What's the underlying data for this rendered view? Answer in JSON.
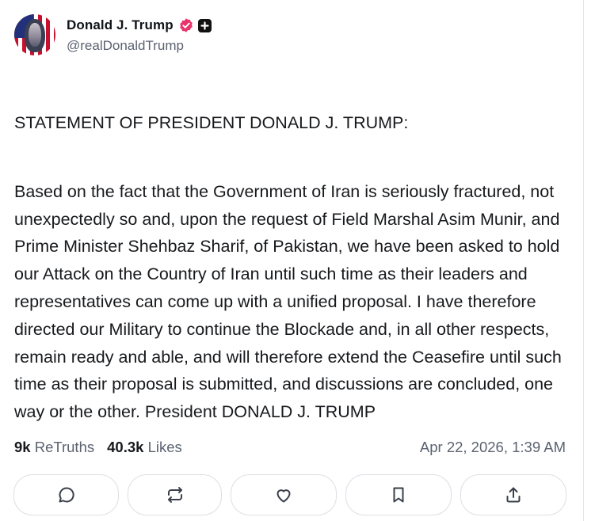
{
  "author": {
    "display_name": "Donald J. Trump",
    "handle": "@realDonaldTrump",
    "verified_icon": "verified-badge-icon",
    "badge_icon": "plus-badge-icon"
  },
  "post": {
    "heading": "STATEMENT OF PRESIDENT DONALD J. TRUMP:",
    "body": "Based on the fact that the Government of Iran is seriously fractured, not unexpectedly so and, upon the request of Field Marshal Asim Munir, and Prime Minister Shehbaz Sharif, of Pakistan, we have been asked to hold our Attack on the Country of Iran until such time as their leaders and representatives can come up with a unified proposal. I have therefore directed our Military to continue the Blockade and, in all other respects, remain ready and able, and will therefore extend the Ceasefire until such time as their proposal is submitted, and discussions are concluded, one way or the other. President DONALD J. TRUMP"
  },
  "stats": {
    "retruths_count": "9k",
    "retruths_label": "ReTruths",
    "likes_count": "40.3k",
    "likes_label": "Likes"
  },
  "timestamp": "Apr 22, 2026, 1:39 AM",
  "actions": [
    {
      "icon": "reply-icon"
    },
    {
      "icon": "retruth-icon"
    },
    {
      "icon": "like-icon"
    },
    {
      "icon": "bookmark-icon"
    },
    {
      "icon": "share-icon"
    }
  ],
  "colors": {
    "verified": "#e8336b",
    "text": "#17191c",
    "muted": "#5b6270",
    "border": "#dcdfe4"
  }
}
